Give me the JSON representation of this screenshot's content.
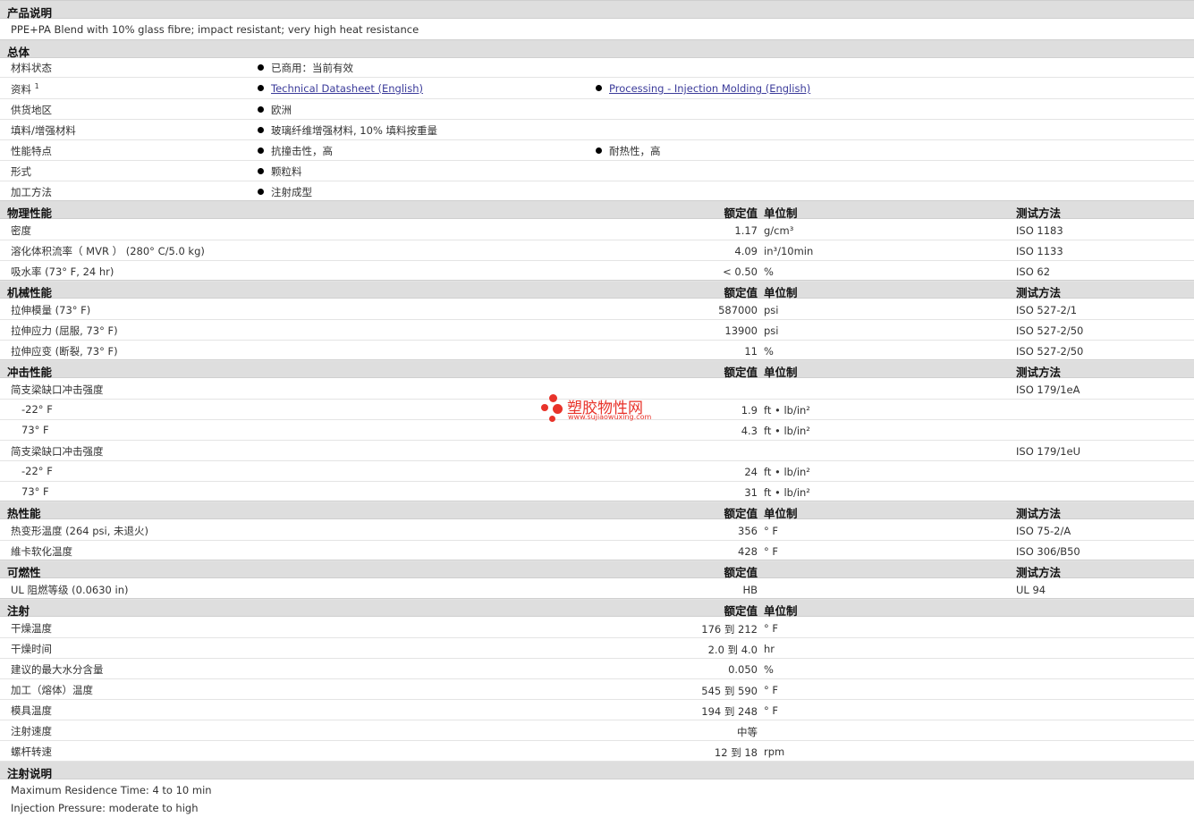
{
  "description": {
    "header": "产品说明",
    "text": "PPE+PA Blend with 10% glass fibre; impact resistant; very high heat resistance"
  },
  "general": {
    "header": "总体",
    "rows": [
      {
        "label": "材料状态",
        "b1": "已商用：当前有效",
        "b2": ""
      },
      {
        "label": "资料",
        "sup": "1",
        "b1": "Technical Datasheet (English)",
        "b2": "Processing - Injection Molding (English)"
      },
      {
        "label": "供货地区",
        "b1": "欧洲",
        "b2": ""
      },
      {
        "label": "填料/增强材料",
        "b1": "玻璃纤维增强材料, 10% 填料按重量",
        "b2": ""
      },
      {
        "label": "性能特点",
        "b1": "抗撞击性，高",
        "b2": "耐热性，高"
      },
      {
        "label": "形式",
        "b1": "颗粒料",
        "b2": ""
      },
      {
        "label": "加工方法",
        "b1": "注射成型",
        "b2": ""
      }
    ]
  },
  "columns": {
    "nominal": "额定值",
    "unit": "单位制",
    "test": "测试方法"
  },
  "physical": {
    "header": "物理性能",
    "rows": [
      {
        "label": "密度",
        "value": "1.17",
        "unit": "g/cm³",
        "test": "ISO 1183"
      },
      {
        "label": "溶化体积流率（ MVR ） (280°  C/5.0 kg)",
        "value": "4.09",
        "unit": "in³/10min",
        "test": "ISO 1133"
      },
      {
        "label": "吸水率 (73°  F, 24 hr)",
        "value": "< 0.50",
        "unit": "%",
        "test": "ISO 62"
      }
    ]
  },
  "mechanical": {
    "header": "机械性能",
    "rows": [
      {
        "label": "拉伸模量 (73°  F)",
        "value": "587000",
        "unit": "psi",
        "test": "ISO 527-2/1"
      },
      {
        "label": "拉伸应力 (屈服, 73°  F)",
        "value": "13900",
        "unit": "psi",
        "test": "ISO 527-2/50"
      },
      {
        "label": "拉伸应变 (断裂, 73°  F)",
        "value": "11",
        "unit": "%",
        "test": "ISO 527-2/50"
      }
    ]
  },
  "impact": {
    "header": "冲击性能",
    "rows": [
      {
        "label": "简支梁缺口冲击强度",
        "sub": false,
        "value": "",
        "unit": "",
        "test": "ISO 179/1eA"
      },
      {
        "label": "-22°  F",
        "sub": true,
        "value": "1.9",
        "unit": "ft • lb/in²",
        "test": ""
      },
      {
        "label": "73°  F",
        "sub": true,
        "value": "4.3",
        "unit": "ft • lb/in²",
        "test": ""
      },
      {
        "label": "简支梁缺口冲击强度",
        "sub": false,
        "value": "",
        "unit": "",
        "test": "ISO 179/1eU"
      },
      {
        "label": "-22°  F",
        "sub": true,
        "value": "24",
        "unit": "ft • lb/in²",
        "test": ""
      },
      {
        "label": "73°  F",
        "sub": true,
        "value": "31",
        "unit": "ft • lb/in²",
        "test": ""
      }
    ]
  },
  "thermal": {
    "header": "热性能",
    "rows": [
      {
        "label": "热变形温度 (264 psi, 未退火)",
        "value": "356",
        "unit": "°  F",
        "test": "ISO 75-2/A"
      },
      {
        "label": "維卡软化温度",
        "value": "428",
        "unit": "°  F",
        "test": "ISO 306/B50"
      }
    ]
  },
  "flammability": {
    "header": "可燃性",
    "rows": [
      {
        "label": "UL 阻燃等级 (0.0630 in)",
        "value": "HB",
        "unit": "",
        "test": "UL 94"
      }
    ]
  },
  "injection": {
    "header": "注射",
    "rows": [
      {
        "label": "干燥温度",
        "value": "176 到  212",
        "unit": "°  F"
      },
      {
        "label": "干燥时间",
        "value": "2.0 到  4.0",
        "unit": "hr"
      },
      {
        "label": "建议的最大水分含量",
        "value": "0.050",
        "unit": "%"
      },
      {
        "label": "加工（熔体）温度",
        "value": "545 到  590",
        "unit": "°  F"
      },
      {
        "label": "模具温度",
        "value": "194 到  248",
        "unit": "°  F"
      },
      {
        "label": "注射速度",
        "value": "中等",
        "unit": ""
      },
      {
        "label": "螺杆转速",
        "value": "12 到  18",
        "unit": "rpm"
      }
    ]
  },
  "injection_notes": {
    "header": "注射说明",
    "lines": [
      "Maximum Residence Time: 4 to 10 min",
      "Injection Pressure: moderate to high"
    ]
  },
  "watermark": {
    "name": "塑胶物性网",
    "url": "www.sujiaowuxing.com",
    "color": "#e8332a"
  }
}
